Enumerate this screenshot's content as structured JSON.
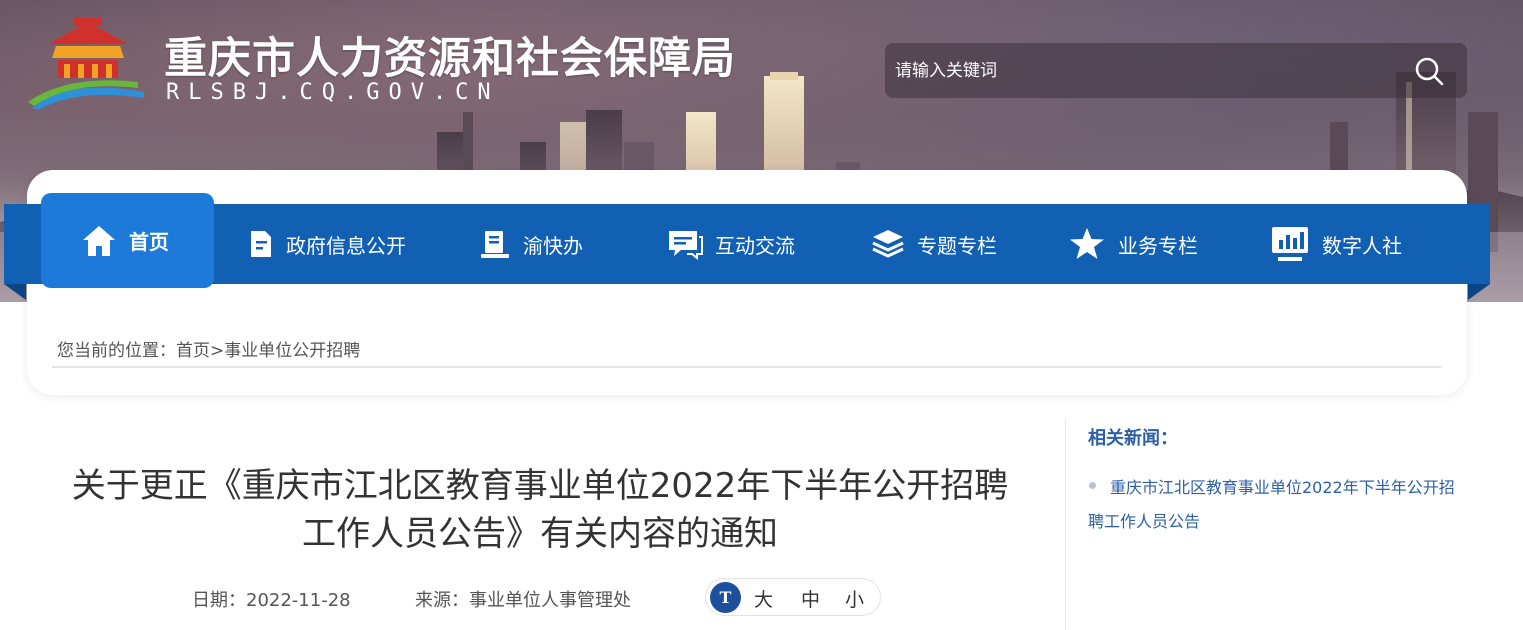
{
  "header": {
    "site_title": "重庆市人力资源和社会保障局",
    "site_domain": "RLSBJ.CQ.GOV.CN",
    "logo_icon": "temple-roof-logo-icon"
  },
  "search": {
    "placeholder": "请输入关键词",
    "icon": "search-icon"
  },
  "nav": {
    "items": [
      {
        "label": "首页",
        "icon": "home-icon",
        "active": true
      },
      {
        "label": "政府信息公开",
        "icon": "document-icon"
      },
      {
        "label": "渝快办",
        "icon": "book-icon"
      },
      {
        "label": "互动交流",
        "icon": "chat-icon"
      },
      {
        "label": "专题专栏",
        "icon": "layers-icon"
      },
      {
        "label": "业务专栏",
        "icon": "star-icon"
      },
      {
        "label": "数字人社",
        "icon": "monitor-chart-icon"
      }
    ]
  },
  "breadcrumb": {
    "prefix": "您当前的位置：",
    "home": "首页",
    "separator": ">",
    "current": "事业单位公开招聘"
  },
  "article": {
    "title": "关于更正《重庆市江北区教育事业单位2022年下半年公开招聘工作人员公告》有关内容的通知",
    "date_label": "日期：",
    "date": "2022-11-28",
    "source_label": "来源：",
    "source": "事业单位人事管理处",
    "font_size": {
      "icon_text": "T",
      "large": "大",
      "medium": "中",
      "small": "小"
    }
  },
  "related": {
    "title": "相关新闻：",
    "items": [
      "重庆市江北区教育事业单位2022年下半年公开招聘工作人员公告"
    ]
  },
  "colors": {
    "nav_blue": "#1160b4",
    "nav_active": "#1d7ad9",
    "link_blue": "#2d5fa6"
  }
}
